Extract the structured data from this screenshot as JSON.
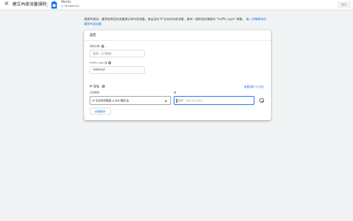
{
  "header": {
    "title": "建立內部流量規則",
    "property": {
      "name": "Merlin",
      "id": "G-1B7BB9D4Z2"
    },
    "save_label": "儲存"
  },
  "intro": {
    "text": "請提供資訊，讓系統將這些流量標示為內部流量。來自這些 IP 位址的內部流量，會有一個附加名稱值的 \"traffic_type\" 參數。",
    "link": "進一步瞭解如何篩除內部流量"
  },
  "card": {
    "title": "設定",
    "rule_name": {
      "label": "規則名稱",
      "placeholder": "範例：公司總部"
    },
    "traffic_type": {
      "label": "traffic_type 值",
      "value": "internal"
    },
    "ip_section": {
      "title": "IP 位址",
      "reference_link": "查看我的 IP 位址",
      "match_type_label": "比對類型",
      "match_type_value": "IP 位址符合範圍 (CIDR 標記法)",
      "value_label": "值",
      "value_placeholder": "範例：192.0.2.0/24",
      "add_condition": "新增條件"
    }
  },
  "colors": {
    "accent": "#1a73e8",
    "badge": "#1a73e8"
  }
}
